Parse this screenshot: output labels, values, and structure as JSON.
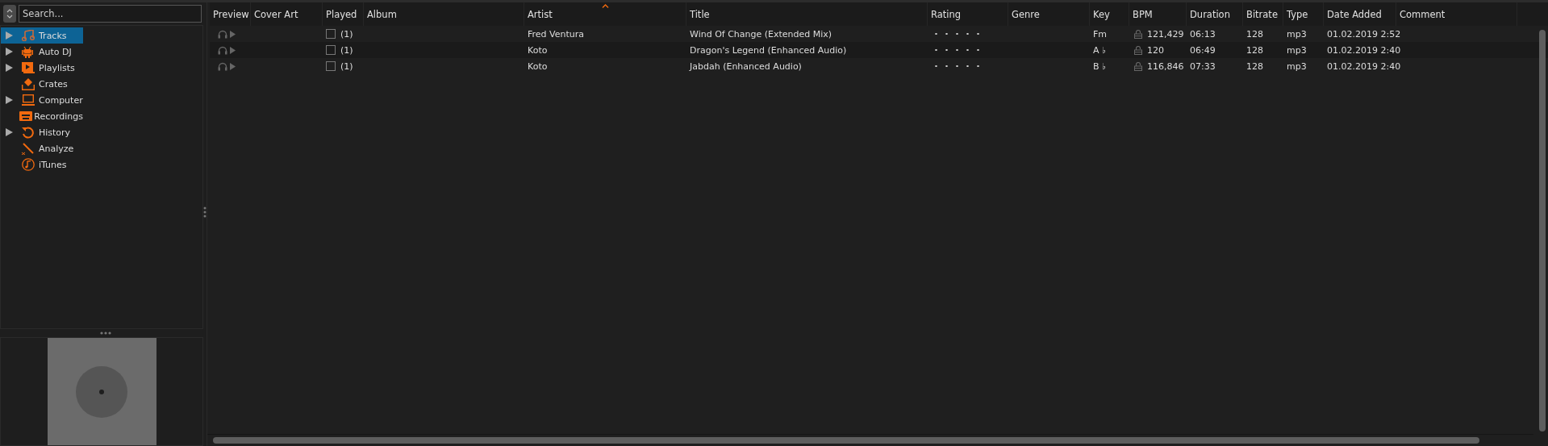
{
  "search": {
    "placeholder": "Search..."
  },
  "sidebar": {
    "items": [
      {
        "label": "Tracks",
        "selected": true,
        "expandable": true
      },
      {
        "label": "Auto DJ",
        "selected": false,
        "expandable": true
      },
      {
        "label": "Playlists",
        "selected": false,
        "expandable": true
      },
      {
        "label": "Crates",
        "selected": false,
        "expandable": false
      },
      {
        "label": "Computer",
        "selected": false,
        "expandable": true
      },
      {
        "label": "Recordings",
        "selected": false,
        "expandable": false
      },
      {
        "label": "History",
        "selected": false,
        "expandable": true
      },
      {
        "label": "Analyze",
        "selected": false,
        "expandable": false
      },
      {
        "label": "iTunes",
        "selected": false,
        "expandable": false
      }
    ]
  },
  "table": {
    "columns": [
      {
        "label": "Preview",
        "sorted": false
      },
      {
        "label": "Cover Art",
        "sorted": false
      },
      {
        "label": "Played",
        "sorted": false
      },
      {
        "label": "Album",
        "sorted": false
      },
      {
        "label": "Artist",
        "sorted": true
      },
      {
        "label": "Title",
        "sorted": false
      },
      {
        "label": "Rating",
        "sorted": false
      },
      {
        "label": "Genre",
        "sorted": false
      },
      {
        "label": "Key",
        "sorted": false
      },
      {
        "label": "BPM",
        "sorted": false
      },
      {
        "label": "Duration",
        "sorted": false
      },
      {
        "label": "Bitrate",
        "sorted": false
      },
      {
        "label": "Type",
        "sorted": false
      },
      {
        "label": "Date Added",
        "sorted": false
      },
      {
        "label": "Comment",
        "sorted": false
      }
    ],
    "rows": [
      {
        "played": false,
        "play_count": "(1)",
        "artist": "Fred Ventura",
        "title": "Wind Of Change (Extended Mix)",
        "key": "Fm",
        "bpm_locked": false,
        "bpm": "121,429",
        "duration": "06:13",
        "bitrate": "128",
        "type": "mp3",
        "date_added": "01.02.2019 2:52"
      },
      {
        "played": false,
        "play_count": "(1)",
        "artist": "Koto",
        "title": "Dragon's Legend (Enhanced Audio)",
        "key": "A ♭",
        "bpm_locked": false,
        "bpm": "120",
        "duration": "06:49",
        "bitrate": "128",
        "type": "mp3",
        "date_added": "01.02.2019 2:40"
      },
      {
        "played": false,
        "play_count": "(1)",
        "artist": "Koto",
        "title": "Jabdah (Enhanced Audio)",
        "key": "B ♭",
        "bpm_locked": false,
        "bpm": "116,846",
        "duration": "07:33",
        "bitrate": "128",
        "type": "mp3",
        "date_added": "01.02.2019 2:40"
      }
    ]
  }
}
